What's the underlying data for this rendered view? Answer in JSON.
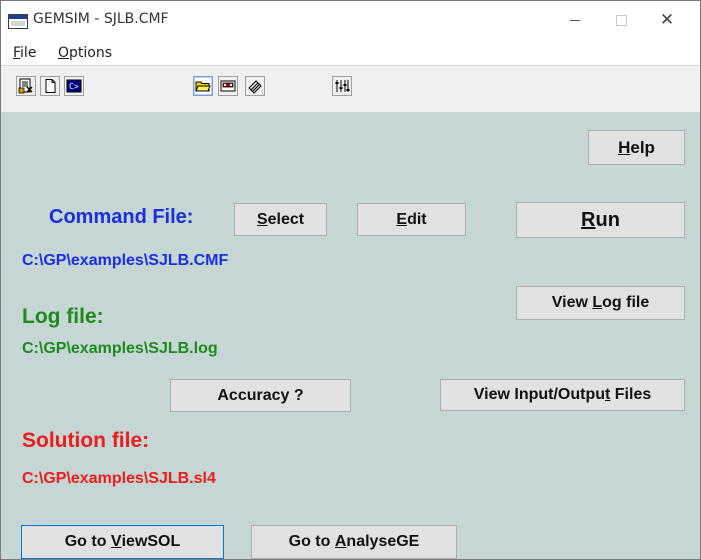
{
  "window": {
    "title": "GEMSIM - SJLB.CMF",
    "minimize_glyph": "—",
    "close_glyph": "✕"
  },
  "menu": {
    "file_accel": "F",
    "file_rest": "ile",
    "options_accel": "O",
    "options_rest": "ptions"
  },
  "toolbar": {
    "buttons": [
      "new-project-icon",
      "new-file-icon",
      "run-dos-icon",
      "open-folder-icon",
      "tape-icon",
      "eraser-icon",
      "sliders-icon"
    ]
  },
  "help": {
    "accel": "H",
    "rest": "elp"
  },
  "command": {
    "label": "Command File:",
    "select_accel": "S",
    "select_rest": "elect",
    "edit_accel": "E",
    "edit_rest": "dit",
    "run_accel": "R",
    "run_rest": "un",
    "path": "C:\\GP\\examples\\SJLB.CMF"
  },
  "log": {
    "label": "Log file:",
    "path": "C:\\GP\\examples\\SJLB.log",
    "view_pre": "View ",
    "view_accel": "L",
    "view_post": "og file"
  },
  "accuracy": {
    "label": "Accuracy ?"
  },
  "io_files": {
    "pre": "View Input/Outpu",
    "accel": "t",
    "post": " Files"
  },
  "solution": {
    "label": "Solution file:",
    "path": "C:\\GP\\examples\\SJLB.sl4"
  },
  "bottom": {
    "viewsol_pre": "Go to ",
    "viewsol_accel": "V",
    "viewsol_post": "iewSOL",
    "analyse_pre": "Go to ",
    "analyse_accel": "A",
    "analyse_post": "nalyseGE"
  },
  "colors": {
    "panel_bg": "#c6d6d4",
    "command_blue": "#1a2ee6",
    "log_green": "#1e8a1e",
    "solution_red": "#ee1c1c"
  }
}
